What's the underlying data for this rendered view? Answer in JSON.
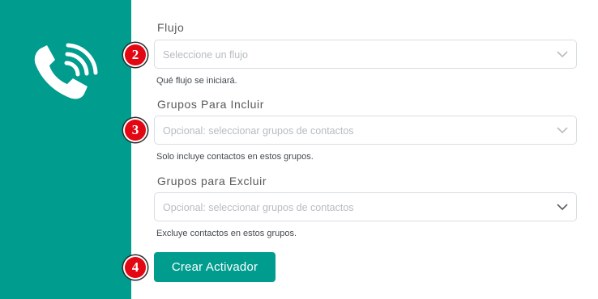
{
  "colors": {
    "brand": "#009c8e",
    "badge": "#e30613"
  },
  "sidebar": {
    "icon": "phone-call-icon"
  },
  "form": {
    "flow": {
      "label": "Flujo",
      "placeholder": "Seleccione un flujo",
      "help": "Qué flujo se iniciará.",
      "step": "2"
    },
    "include_groups": {
      "label": "Grupos Para Incluir",
      "placeholder": "Opcional: seleccionar grupos de contactos",
      "help": "Solo incluye contactos en estos grupos.",
      "step": "3"
    },
    "exclude_groups": {
      "label": "Grupos para Excluir",
      "placeholder": "Opcional: seleccionar grupos de contactos",
      "help": "Excluye contactos en estos grupos."
    },
    "submit": {
      "label": "Crear Activador",
      "step": "4"
    }
  }
}
